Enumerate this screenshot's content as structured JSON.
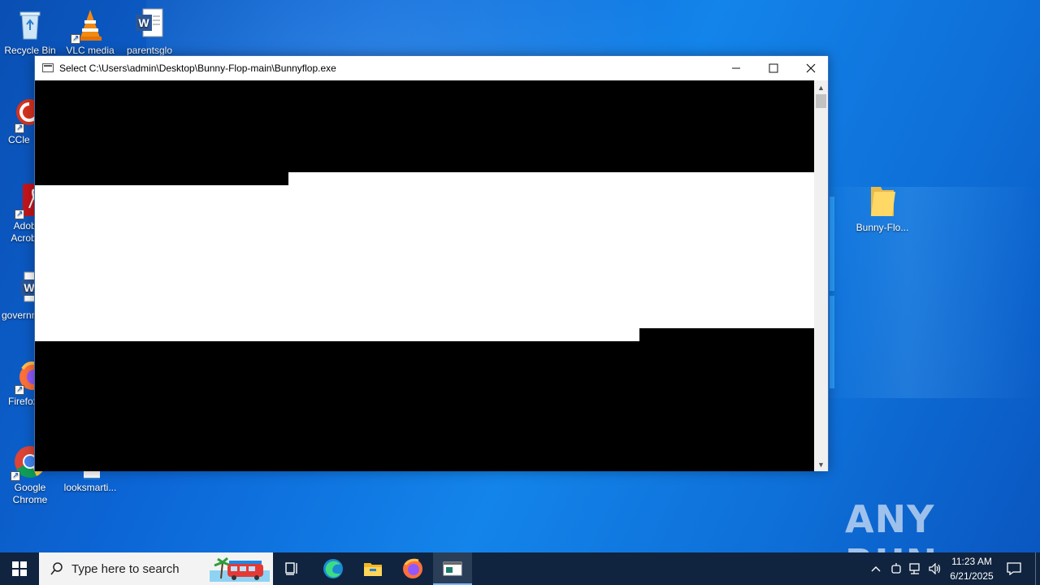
{
  "desktop": {
    "icons": [
      {
        "label": "Recycle Bin",
        "icon": "recycle-bin-icon"
      },
      {
        "label": "VLC media",
        "icon": "vlc-icon"
      },
      {
        "label": "parentsglo",
        "icon": "word-document-icon"
      },
      {
        "label": "CCleaner",
        "icon": "ccleaner-icon"
      },
      {
        "label": "Adobe Acrobat",
        "icon": "acrobat-icon"
      },
      {
        "label": "governm",
        "icon": "word-document-icon"
      },
      {
        "label": "Firefox",
        "icon": "firefox-icon"
      },
      {
        "label": "Google Chrome",
        "icon": "chrome-icon"
      },
      {
        "label": "looksmarti...",
        "icon": "document-icon"
      },
      {
        "label": "Bunny-Flo...",
        "icon": "folder-icon"
      }
    ]
  },
  "window": {
    "title": "Select C:\\Users\\admin\\Desktop\\Bunny-Flop-main\\Bunnyflop.exe",
    "controls": {
      "minimize": "—",
      "maximize": "☐",
      "close": "✕"
    }
  },
  "taskbar": {
    "search_placeholder": "Type here to search",
    "apps": [
      "task-view-icon",
      "edge-icon",
      "file-explorer-icon",
      "firefox-icon",
      "console-icon"
    ],
    "clock_time": "11:23 AM",
    "clock_date": "6/21/2025"
  },
  "watermark": "ANY RUN",
  "colors": {
    "accent": "#0c66d6",
    "taskbar": "#10243f",
    "console": "#000000"
  }
}
